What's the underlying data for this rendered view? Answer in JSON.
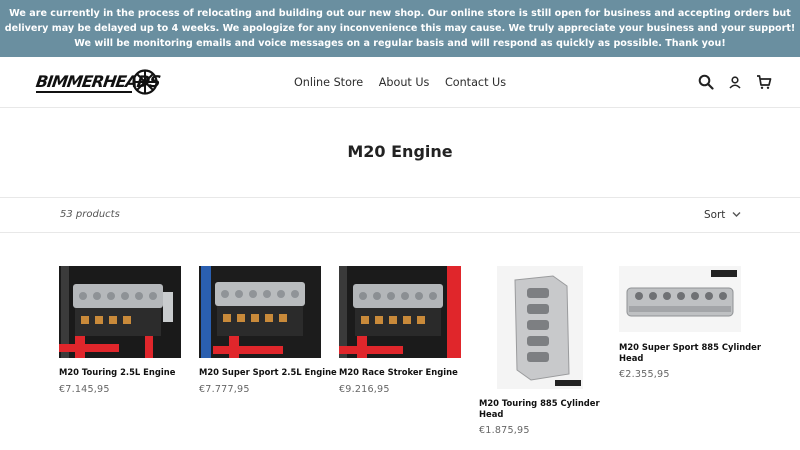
{
  "announcement": {
    "lines": [
      "We are currently in the process of relocating and building out our new shop. Our online store is still open for business and accepting orders but",
      "delivery may be delayed up to 4 weeks. We apologize for any inconvenience this may cause. We truly appreciate your business and your support!",
      "We will be monitoring emails and voice messages on a regular basis and will respond as quickly as possible. Thank you!"
    ]
  },
  "header": {
    "logo_text": "BIMMERHEADS",
    "nav": [
      "Online Store",
      "About Us",
      "Contact Us"
    ],
    "icons": [
      "search-icon",
      "user-icon",
      "cart-icon"
    ]
  },
  "collection": {
    "title": "M20 Engine",
    "count": "53 products",
    "sort_label": "Sort"
  },
  "products": [
    {
      "name": "M20 Touring 2.5L Engine",
      "price": "€7.145,95"
    },
    {
      "name": "M20 Super Sport 2.5L Engine",
      "price": "€7.777,95"
    },
    {
      "name": "M20 Race Stroker Engine",
      "price": "€9.216,95"
    },
    {
      "name_lines": [
        "M20 Touring 885 Cylinder",
        "Head"
      ],
      "price": "€1.875,95"
    },
    {
      "name_lines": [
        "M20 Super Sport 885 Cylinder",
        "Head"
      ],
      "price": "€2.355,95"
    }
  ],
  "colors": {
    "announcement_bg": "#6a8fa0",
    "engine_stand": "#e0262b"
  }
}
